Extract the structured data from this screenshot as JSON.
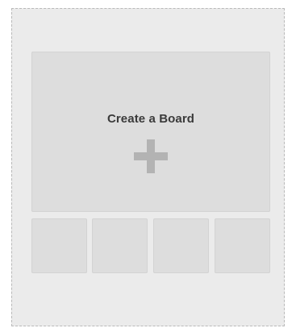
{
  "create_board": {
    "title": "Create a Board",
    "icon": "plus-icon"
  },
  "thumbnails": {
    "count_visible": 4
  },
  "colors": {
    "card_background": "#ebebeb",
    "card_border": "#b9b9b9",
    "tile_background": "#dddddd",
    "title_text": "#3a3a3a",
    "plus_icon": "#b3b3b3"
  }
}
